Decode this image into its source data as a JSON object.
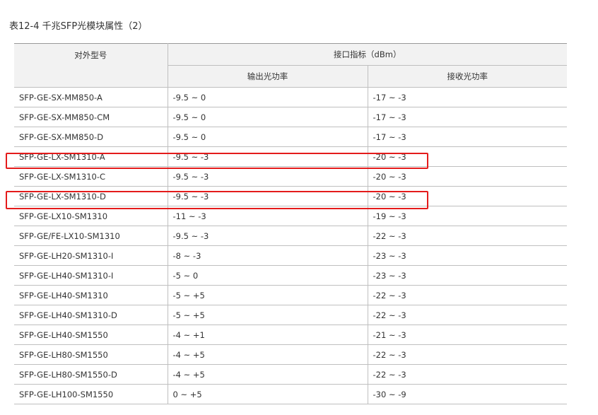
{
  "caption": "表12-4 千兆SFP光模块属性（2）",
  "table": {
    "header_model": "对外型号",
    "header_interface": "接口指标（dBm）",
    "header_tx": "输出光功率",
    "header_rx": "接收光功率",
    "rows": [
      {
        "model": "SFP-GE-SX-MM850-A",
        "tx": "-9.5 ~ 0",
        "rx": "-17 ~ -3"
      },
      {
        "model": "SFP-GE-SX-MM850-CM",
        "tx": "-9.5 ~ 0",
        "rx": "-17 ~ -3"
      },
      {
        "model": "SFP-GE-SX-MM850-D",
        "tx": "-9.5 ~ 0",
        "rx": "-17 ~ -3"
      },
      {
        "model": "SFP-GE-LX-SM1310-A",
        "tx": "-9.5 ~ -3",
        "rx": "-20 ~ -3"
      },
      {
        "model": "SFP-GE-LX-SM1310-C",
        "tx": "-9.5 ~ -3",
        "rx": "-20 ~ -3"
      },
      {
        "model": "SFP-GE-LX-SM1310-D",
        "tx": "-9.5 ~ -3",
        "rx": "-20 ~ -3"
      },
      {
        "model": "SFP-GE-LX10-SM1310",
        "tx": "-11 ~ -3",
        "rx": "-19 ~ -3"
      },
      {
        "model": "SFP-GE/FE-LX10-SM1310",
        "tx": "-9.5 ~ -3",
        "rx": "-22 ~ -3"
      },
      {
        "model": "SFP-GE-LH20-SM1310-I",
        "tx": "-8 ~ -3",
        "rx": "-23 ~ -3"
      },
      {
        "model": "SFP-GE-LH40-SM1310-I",
        "tx": "-5 ~ 0",
        "rx": "-23 ~ -3"
      },
      {
        "model": "SFP-GE-LH40-SM1310",
        "tx": "-5 ~ +5",
        "rx": "-22 ~ -3"
      },
      {
        "model": "SFP-GE-LH40-SM1310-D",
        "tx": "-5 ~ +5",
        "rx": "-22 ~ -3"
      },
      {
        "model": "SFP-GE-LH40-SM1550",
        "tx": "-4 ~ +1",
        "rx": "-21 ~ -3"
      },
      {
        "model": "SFP-GE-LH80-SM1550",
        "tx": "-4 ~ +5",
        "rx": "-22 ~ -3"
      },
      {
        "model": "SFP-GE-LH80-SM1550-D",
        "tx": "-4 ~ +5",
        "rx": "-22 ~ -3"
      },
      {
        "model": "SFP-GE-LH100-SM1550",
        "tx": "0 ~ +5",
        "rx": "-30 ~ -9"
      }
    ]
  },
  "highlight_color": "#e41b1b"
}
